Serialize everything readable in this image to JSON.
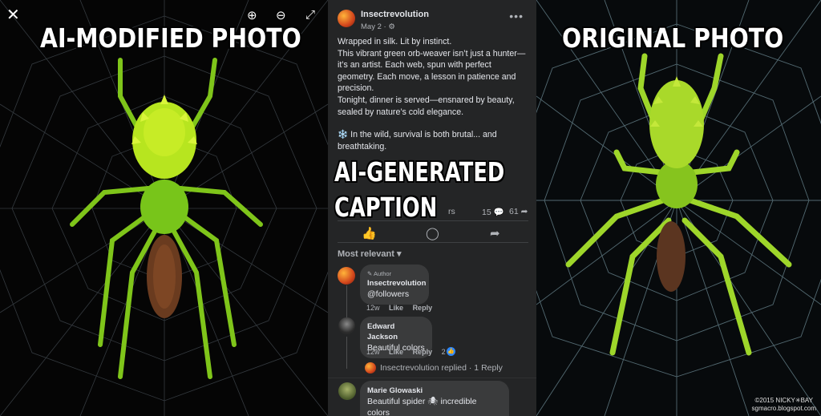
{
  "labels": {
    "left": "AI-MODIFIED PHOTO",
    "right": "ORIGINAL PHOTO",
    "middle_line1": "AI-GENERATED",
    "middle_line2": "CAPTION"
  },
  "viewer": {
    "close_icon": "close-icon",
    "zoom_in_icon": "zoom-in-icon",
    "zoom_out_icon": "zoom-out-icon",
    "expand_icon": "expand-icon"
  },
  "post": {
    "author": "Insectrevolution",
    "date": "May 2 ·",
    "paragraphs": [
      "Wrapped in silk. Lit by instinct.",
      "This vibrant green orb-weaver isn’t just a hunter—it’s an artist. Each web, spun with perfect geometry. Each move, a lesson in patience and precision.",
      "Tonight, dinner is served—ensnared by beauty, sealed by nature’s cold elegance.",
      "❄️ In the wild, survival is both brutal... and breathtaking."
    ],
    "followers_fragment": "rs",
    "comments_count": "15",
    "shares_count": "61",
    "sort_label": "Most relevant"
  },
  "comments": [
    {
      "badge": "Author",
      "author": "Insectrevolution",
      "text": "@followers",
      "time": "12w",
      "like": "Like",
      "reply": "Reply"
    },
    {
      "author": "Edward Jackson",
      "text": "Beautiful colors",
      "time": "12w",
      "like": "Like",
      "reply": "Reply",
      "reactions": "2"
    },
    {
      "author": "Marie Glowaski",
      "text": "Beautiful spider 🕷 incredible",
      "text2": "colors"
    }
  ],
  "reply_summary": "Insectrevolution replied · 1 Reply",
  "copyright": {
    "line1": "©2015 NICKY✳BAY",
    "line2": "sgmacro.blogspot.com"
  },
  "colors": {
    "spider_ai": "#8fd51f",
    "spider_original": "#9ed62a",
    "panel_bg": "#242526",
    "link_blue": "#2d88ff"
  }
}
